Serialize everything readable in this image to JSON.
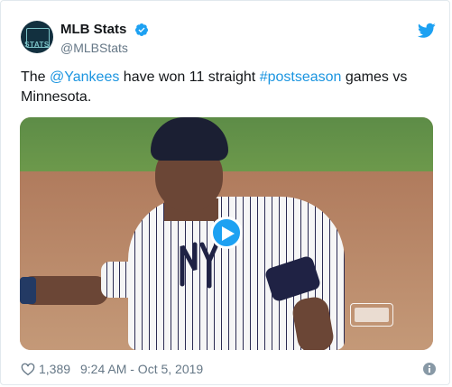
{
  "user": {
    "display_name": "MLB Stats",
    "handle": "@MLBStats",
    "avatar_text": "STATS",
    "verified": true
  },
  "tweet": {
    "text_before": "The ",
    "mention": "@Yankees",
    "text_middle": " have won 11 straight ",
    "hashtag": "#postseason",
    "text_after": " games vs Minnesota."
  },
  "media": {
    "type": "video",
    "player_brand": "MLB"
  },
  "footer": {
    "likes": "1,389",
    "timestamp": "9:24 AM - Oct 5, 2019"
  },
  "colors": {
    "link": "#1b95e0",
    "twitter_blue": "#1da1f2",
    "text": "#14171a",
    "muted": "#657786"
  },
  "icons": {
    "verified": "verified-badge-icon",
    "brand": "twitter-bird-icon",
    "like": "heart-icon",
    "info": "info-icon",
    "play": "play-icon"
  }
}
